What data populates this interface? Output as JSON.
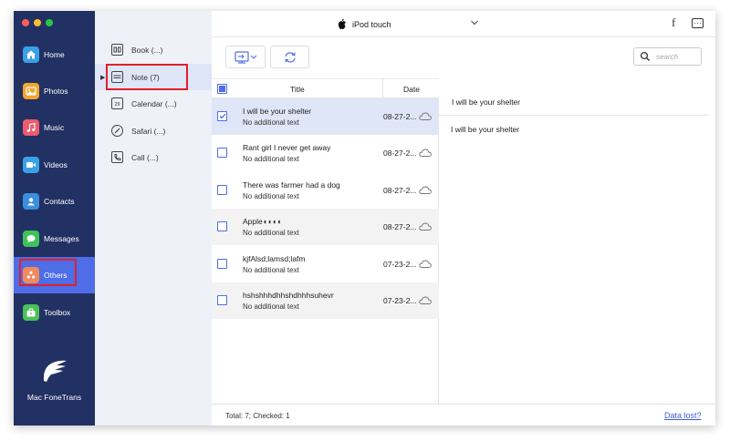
{
  "nav": {
    "items": [
      {
        "label": "Home",
        "icon": "home-icon",
        "color": "#3aa0e8"
      },
      {
        "label": "Photos",
        "icon": "photos-icon",
        "color": "#f2a62e"
      },
      {
        "label": "Music",
        "icon": "music-icon",
        "color": "#ee5a6e"
      },
      {
        "label": "Videos",
        "icon": "videos-icon",
        "color": "#3aa0e8"
      },
      {
        "label": "Contacts",
        "icon": "contacts-icon",
        "color": "#3b8fe0"
      },
      {
        "label": "Messages",
        "icon": "messages-icon",
        "color": "#3ec25a"
      },
      {
        "label": "Others",
        "icon": "others-icon",
        "color": "#f08a5d"
      },
      {
        "label": "Toolbox",
        "icon": "toolbox-icon",
        "color": "#4cc05a"
      }
    ],
    "active": "Others",
    "brand": "Mac FoneTrans"
  },
  "categories": {
    "items": [
      {
        "label": "Book (...)",
        "icon": "book-icon"
      },
      {
        "label": "Note (7)",
        "icon": "note-icon"
      },
      {
        "label": "Calendar (...)",
        "icon": "calendar-icon",
        "badge": "29"
      },
      {
        "label": "Safari (...)",
        "icon": "safari-icon"
      },
      {
        "label": "Call (...)",
        "icon": "call-icon"
      }
    ],
    "active": "Note (7)"
  },
  "topbar": {
    "device": "iPod touch",
    "facebook": "f"
  },
  "search": {
    "placeholder": "search"
  },
  "list": {
    "headers": {
      "title": "Title",
      "date": "Date"
    },
    "rows": [
      {
        "title": "I will be your shelter",
        "sub": "No additional text",
        "date": "08-27-2...",
        "checked": true
      },
      {
        "title": "Rant girl I never get away",
        "sub": "No additional text",
        "date": "08-27-2...",
        "checked": false
      },
      {
        "title": "There was farmer had a dog",
        "sub": "No additional text",
        "date": "08-27-2...",
        "checked": false
      },
      {
        "title": "Apple◖◖◖◖",
        "sub": "No additional text",
        "date": "08-27-2...",
        "checked": false
      },
      {
        "title": "kjfAlsd;lamsd;lafm",
        "sub": "No additional text",
        "date": "07-23-2...",
        "checked": false
      },
      {
        "title": "hshshhhdhhshdhhhsuhevr",
        "sub": "No additional text",
        "date": "07-23-2...",
        "checked": false
      }
    ]
  },
  "detail": {
    "title": "I will be your shelter",
    "body": "I will be your shelter"
  },
  "footer": {
    "total": "Total: 7; Checked: 1",
    "data_lost": "Data lost?"
  },
  "colors": {
    "nav_bg": "#223163",
    "accent": "#4e6de6",
    "highlight": "#e0202a"
  }
}
